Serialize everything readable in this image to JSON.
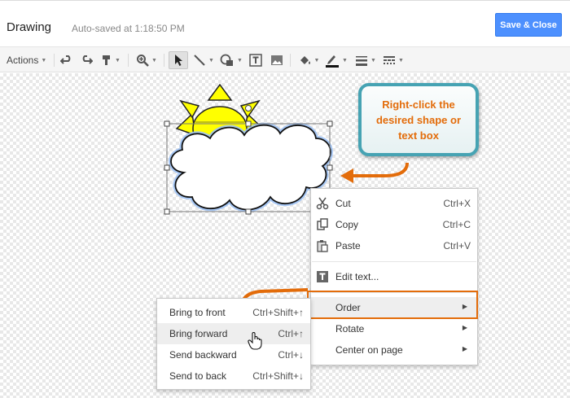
{
  "header": {
    "title": "Drawing",
    "autosave": "Auto-saved at 1:18:50 PM",
    "save_close": "Save & Close"
  },
  "toolbar": {
    "actions_label": "Actions",
    "icons": [
      "undo-icon",
      "redo-icon",
      "paint-format-icon",
      "zoom-icon",
      "select-icon",
      "line-icon",
      "shape-icon",
      "text-box-icon",
      "image-icon",
      "fill-color-icon",
      "line-color-icon",
      "line-weight-icon",
      "line-dash-icon"
    ]
  },
  "callout": {
    "text": "Right-click the desired shape or text box",
    "text_color": "#e36c0a",
    "border_color": "#46a3b3"
  },
  "context_menu": {
    "items": [
      {
        "label": "Cut",
        "shortcut": "Ctrl+X",
        "icon": "scissors-icon"
      },
      {
        "label": "Copy",
        "shortcut": "Ctrl+C",
        "icon": "copy-icon"
      },
      {
        "label": "Paste",
        "shortcut": "Ctrl+V",
        "icon": "paste-icon"
      },
      {
        "label": "Edit text...",
        "shortcut": "",
        "icon": "edit-text-icon"
      },
      {
        "label": "Order",
        "shortcut": "",
        "icon": ""
      },
      {
        "label": "Rotate",
        "shortcut": "",
        "icon": ""
      },
      {
        "label": "Center on page",
        "shortcut": "",
        "icon": ""
      }
    ],
    "highlight_color": "#e36c0a"
  },
  "order_submenu": {
    "items": [
      {
        "label": "Bring to front",
        "shortcut": "Ctrl+Shift+↑"
      },
      {
        "label": "Bring forward",
        "shortcut": "Ctrl+↑"
      },
      {
        "label": "Send backward",
        "shortcut": "Ctrl+↓"
      },
      {
        "label": "Send to back",
        "shortcut": "Ctrl+Shift+↓"
      }
    ]
  },
  "colors": {
    "accent_button": "#4d90fe",
    "sun_fill": "#ffff00",
    "arrow": "#e36c0a"
  }
}
